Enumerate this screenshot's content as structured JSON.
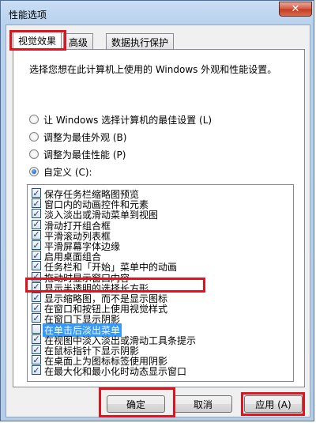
{
  "window": {
    "title": "性能选项",
    "close_glyph": "✕"
  },
  "tabs": [
    {
      "label": "视觉效果",
      "active": true
    },
    {
      "label": "高级",
      "active": false
    },
    {
      "label": "数据执行保护",
      "active": false
    }
  ],
  "description": "选择您想在此计算机上使用的 Windows 外观和性能设置。",
  "radios": [
    {
      "label": "让 Windows 选择计算机的最佳设置 (L)",
      "checked": false
    },
    {
      "label": "调整为最佳外观 (B)",
      "checked": false
    },
    {
      "label": "调整为最佳性能 (P)",
      "checked": false
    },
    {
      "label": "自定义 (C):",
      "checked": true
    }
  ],
  "options": [
    {
      "label": "保存任务栏缩略图预览",
      "checked": true
    },
    {
      "label": "窗口内的动画控件和元素",
      "checked": true
    },
    {
      "label": "淡入淡出或滑动菜单到视图",
      "checked": true
    },
    {
      "label": "滑动打开组合框",
      "checked": true
    },
    {
      "label": "平滑滚动列表框",
      "checked": true
    },
    {
      "label": "平滑屏幕字体边缘",
      "checked": true
    },
    {
      "label": "启用桌面组合",
      "checked": true
    },
    {
      "label": "任务栏和「开始」菜单中的动画",
      "checked": true
    },
    {
      "label": "拖动时显示窗口内容",
      "checked": true
    },
    {
      "label": "显示半透明的选择长方形",
      "checked": true
    },
    {
      "label": "显示缩略图，而不是显示图标",
      "checked": true
    },
    {
      "label": "在窗口和按钮上使用视觉样式",
      "checked": true
    },
    {
      "label": "在窗口下显示阴影",
      "checked": true
    },
    {
      "label": "在单击后淡出菜单",
      "checked": false,
      "selected": true
    },
    {
      "label": "在视图中淡入淡出或滑动工具条提示",
      "checked": true
    },
    {
      "label": "在鼠标指针下显示阴影",
      "checked": true
    },
    {
      "label": "在桌面上为图标标签使用阴影",
      "checked": true
    },
    {
      "label": "在最大化和最小化时动态显示窗口",
      "checked": true
    }
  ],
  "buttons": {
    "ok": "确定",
    "cancel": "取消",
    "apply": "应用 (A)"
  },
  "check_glyph": "✓",
  "highlight_color": "#e0141e"
}
